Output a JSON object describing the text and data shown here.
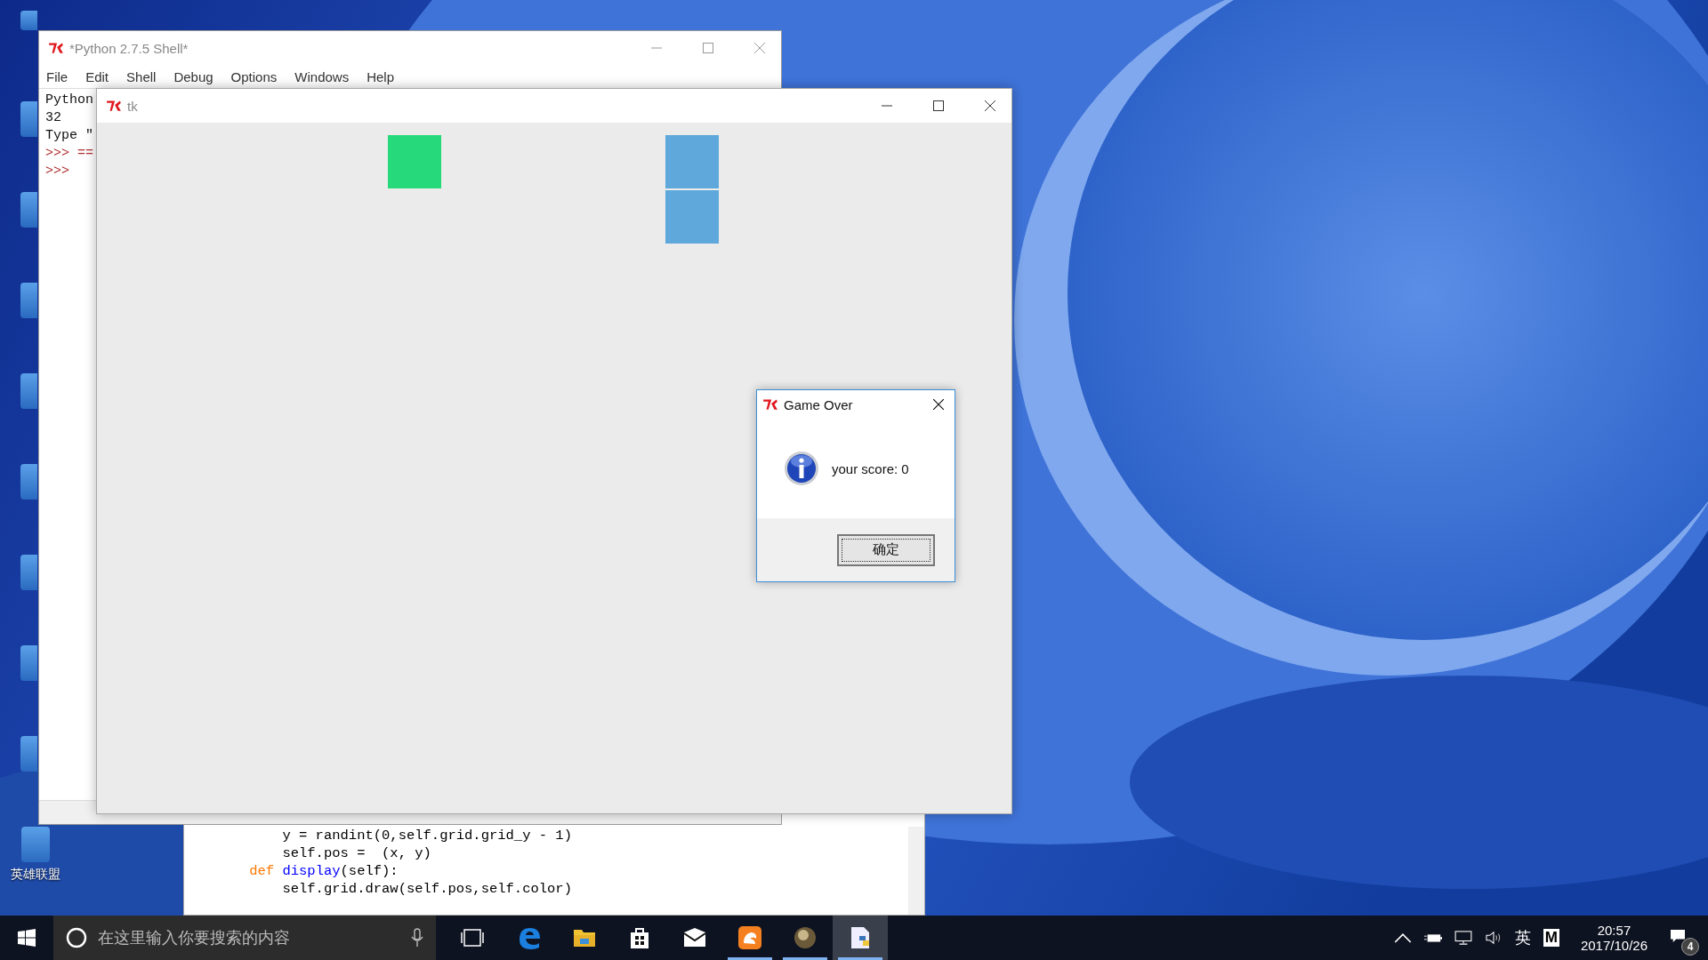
{
  "desktop_icon": {
    "label": "英雄联盟"
  },
  "shell_window": {
    "title": "*Python 2.7.5 Shell*",
    "menu": [
      "File",
      "Edit",
      "Shell",
      "Debug",
      "Options",
      "Windows",
      "Help"
    ],
    "lines": [
      {
        "text": "Python",
        "kind": "output"
      },
      {
        "text": "32",
        "kind": "output"
      },
      {
        "text": "Type \"",
        "kind": "output"
      },
      {
        "text": ">>> ==",
        "kind": "prompt"
      },
      {
        "text": ">>>",
        "kind": "prompt"
      }
    ]
  },
  "editor_window": {
    "lines": [
      [
        {
          "text": "        y = randint(0,self.grid.grid_y - 1)",
          "kind": "plain"
        }
      ],
      [
        {
          "text": "        self.pos =  (x, y)",
          "kind": "plain"
        }
      ],
      [
        {
          "text": "    def",
          "kind": "keyword"
        },
        {
          "text": " display",
          "kind": "name"
        },
        {
          "text": "(self):",
          "kind": "plain"
        }
      ],
      [
        {
          "text": "        self.grid.draw(self.pos,self.color)",
          "kind": "plain"
        }
      ]
    ]
  },
  "tk_window": {
    "title": "tk",
    "blocks": [
      {
        "kind": "food",
        "color": "#26d97a"
      },
      {
        "kind": "snake",
        "color": "#5fa8db"
      },
      {
        "kind": "snake",
        "color": "#5fa8db"
      }
    ]
  },
  "dialog": {
    "title": "Game Over",
    "message": "your score: 0",
    "button": "确定"
  },
  "taskbar": {
    "search": {
      "placeholder": "在这里输入你要搜索的内容"
    },
    "apps": [
      {
        "kind": "edge",
        "running": false,
        "selected": false
      },
      {
        "kind": "folder",
        "running": false,
        "selected": false
      },
      {
        "kind": "store",
        "running": false,
        "selected": false
      },
      {
        "kind": "mail",
        "running": false,
        "selected": false
      },
      {
        "kind": "uc",
        "running": true,
        "selected": false
      },
      {
        "kind": "game",
        "running": true,
        "selected": false
      },
      {
        "kind": "python",
        "running": true,
        "selected": true
      }
    ],
    "input_language": "英",
    "ime": "M",
    "time": "20:57",
    "date": "2017/10/26",
    "notifications": "4"
  }
}
